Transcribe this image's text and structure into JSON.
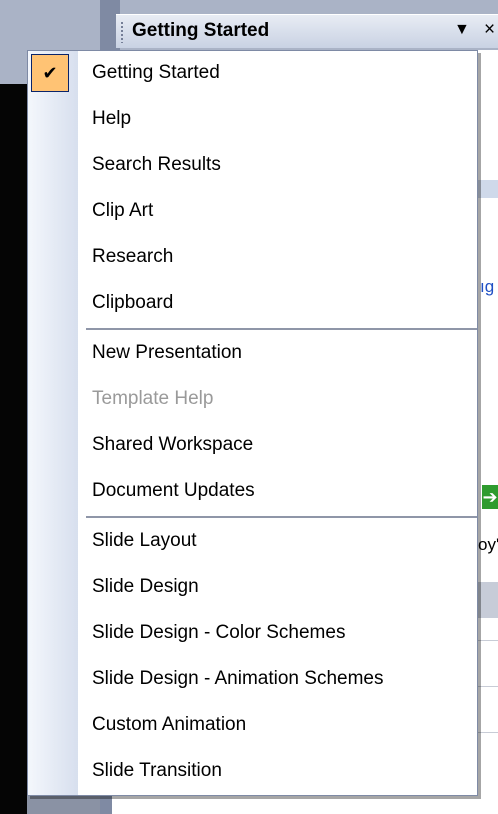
{
  "task_pane": {
    "title": "Getting Started",
    "dropdown_icon": "triangle-down-icon",
    "close_label": "×"
  },
  "background": {
    "link_fragment": "ıg",
    "arrow_glyph": "➔",
    "text_fragment": "oy'"
  },
  "menu": {
    "groups": [
      [
        {
          "label": "Getting Started",
          "checked": true
        },
        {
          "label": "Help"
        },
        {
          "label": "Search Results"
        },
        {
          "label": "Clip Art"
        },
        {
          "label": "Research"
        },
        {
          "label": "Clipboard"
        }
      ],
      [
        {
          "label": "New Presentation"
        },
        {
          "label": "Template Help",
          "disabled": true
        },
        {
          "label": "Shared Workspace"
        },
        {
          "label": "Document Updates"
        }
      ],
      [
        {
          "label": "Slide Layout"
        },
        {
          "label": "Slide Design"
        },
        {
          "label": "Slide Design - Color Schemes"
        },
        {
          "label": "Slide Design - Animation Schemes"
        },
        {
          "label": "Custom Animation"
        },
        {
          "label": "Slide Transition"
        }
      ]
    ],
    "check_glyph": "✔",
    "accent_color": "#ffc374"
  }
}
